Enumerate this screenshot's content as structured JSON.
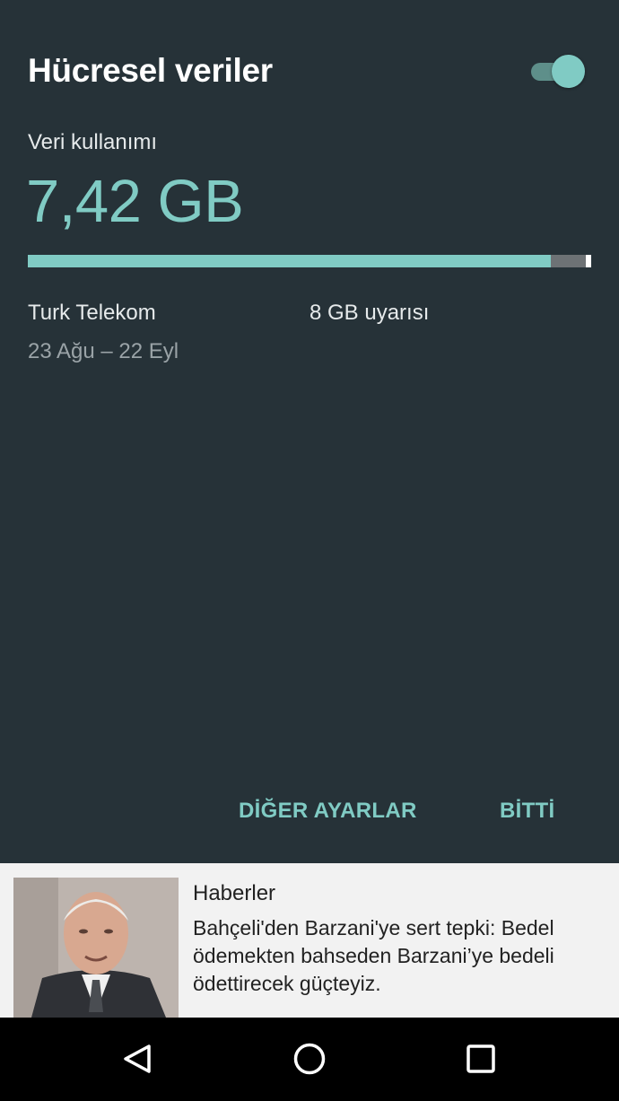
{
  "panel": {
    "title": "Hücresel veriler",
    "toggle_on": true,
    "usage_label": "Veri kullanımı",
    "usage_amount": "7,42 GB",
    "usage_fraction": 0.928,
    "carrier": "Turk Telekom",
    "warning": "8 GB uyarısı",
    "cycle": "23 Ağu – 22 Eyl",
    "buttons": {
      "more_settings": "DİĞER AYARLAR",
      "done": "BİTTİ"
    }
  },
  "notification": {
    "app_name": "Haberler",
    "text": "Bahçeli'den Barzani'ye sert tepki: Bedel ödemekten bahseden Barzani’ye bedeli ödettirecek güçteyiz."
  },
  "nav": {
    "icons": [
      "back-icon",
      "home-icon",
      "recents-icon"
    ]
  },
  "colors": {
    "accent": "#80cbc4",
    "background": "#263238",
    "bar_remaining": "#6d7275"
  }
}
